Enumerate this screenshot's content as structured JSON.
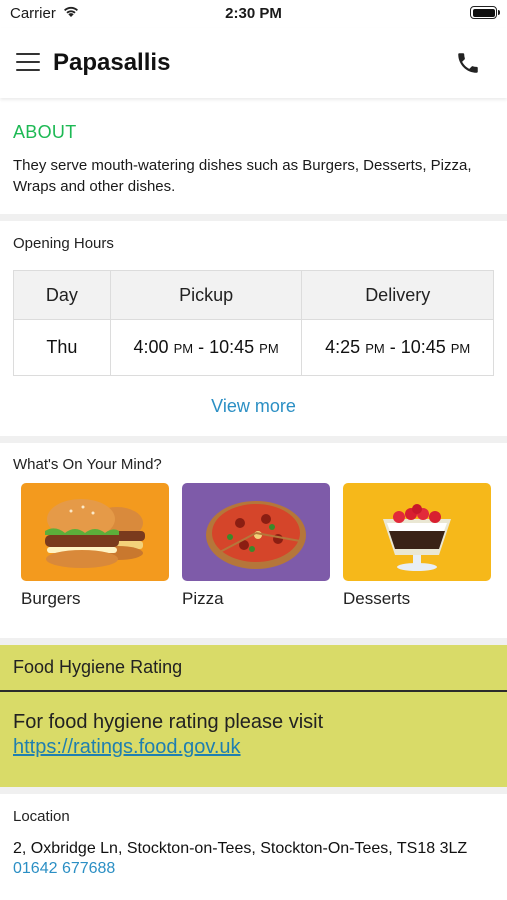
{
  "status_bar": {
    "carrier": "Carrier",
    "time": "2:30 PM"
  },
  "header": {
    "title": "Papasallis"
  },
  "about": {
    "title": "ABOUT",
    "text": "They serve mouth-watering dishes such as Burgers, Desserts, Pizza, Wraps and other dishes."
  },
  "opening_hours": {
    "title": "Opening Hours",
    "columns": [
      "Day",
      "Pickup",
      "Delivery"
    ],
    "row": {
      "day": "Thu",
      "pickup_start": "4:00",
      "pickup_start_ampm": "PM",
      "pickup_end": "10:45",
      "pickup_end_ampm": "PM",
      "delivery_start": "4:25",
      "delivery_start_ampm": "PM",
      "delivery_end": "10:45",
      "delivery_end_ampm": "PM"
    },
    "separator": " - ",
    "view_more": "View more"
  },
  "mind": {
    "title": "What's On Your Mind?",
    "categories": [
      {
        "label": "Burgers",
        "bg_color": "#f39a1e",
        "icon": "burger-icon"
      },
      {
        "label": "Pizza",
        "bg_color": "#7e5ba9",
        "icon": "pizza-icon"
      },
      {
        "label": "Desserts",
        "bg_color": "#f6b81a",
        "icon": "dessert-icon"
      }
    ]
  },
  "hygiene": {
    "title": "Food Hygiene Rating",
    "text": "For food hygiene rating please visit",
    "link": "https://ratings.food.gov.uk",
    "bg_color": "#d9db68"
  },
  "location": {
    "title": "Location",
    "address": "2, Oxbridge Ln, Stockton-on-Tees, Stockton-On-Tees, TS18 3LZ",
    "phone": "01642 677688"
  },
  "colors": {
    "accent_green": "#1db954",
    "link_blue": "#2b8fc4"
  }
}
